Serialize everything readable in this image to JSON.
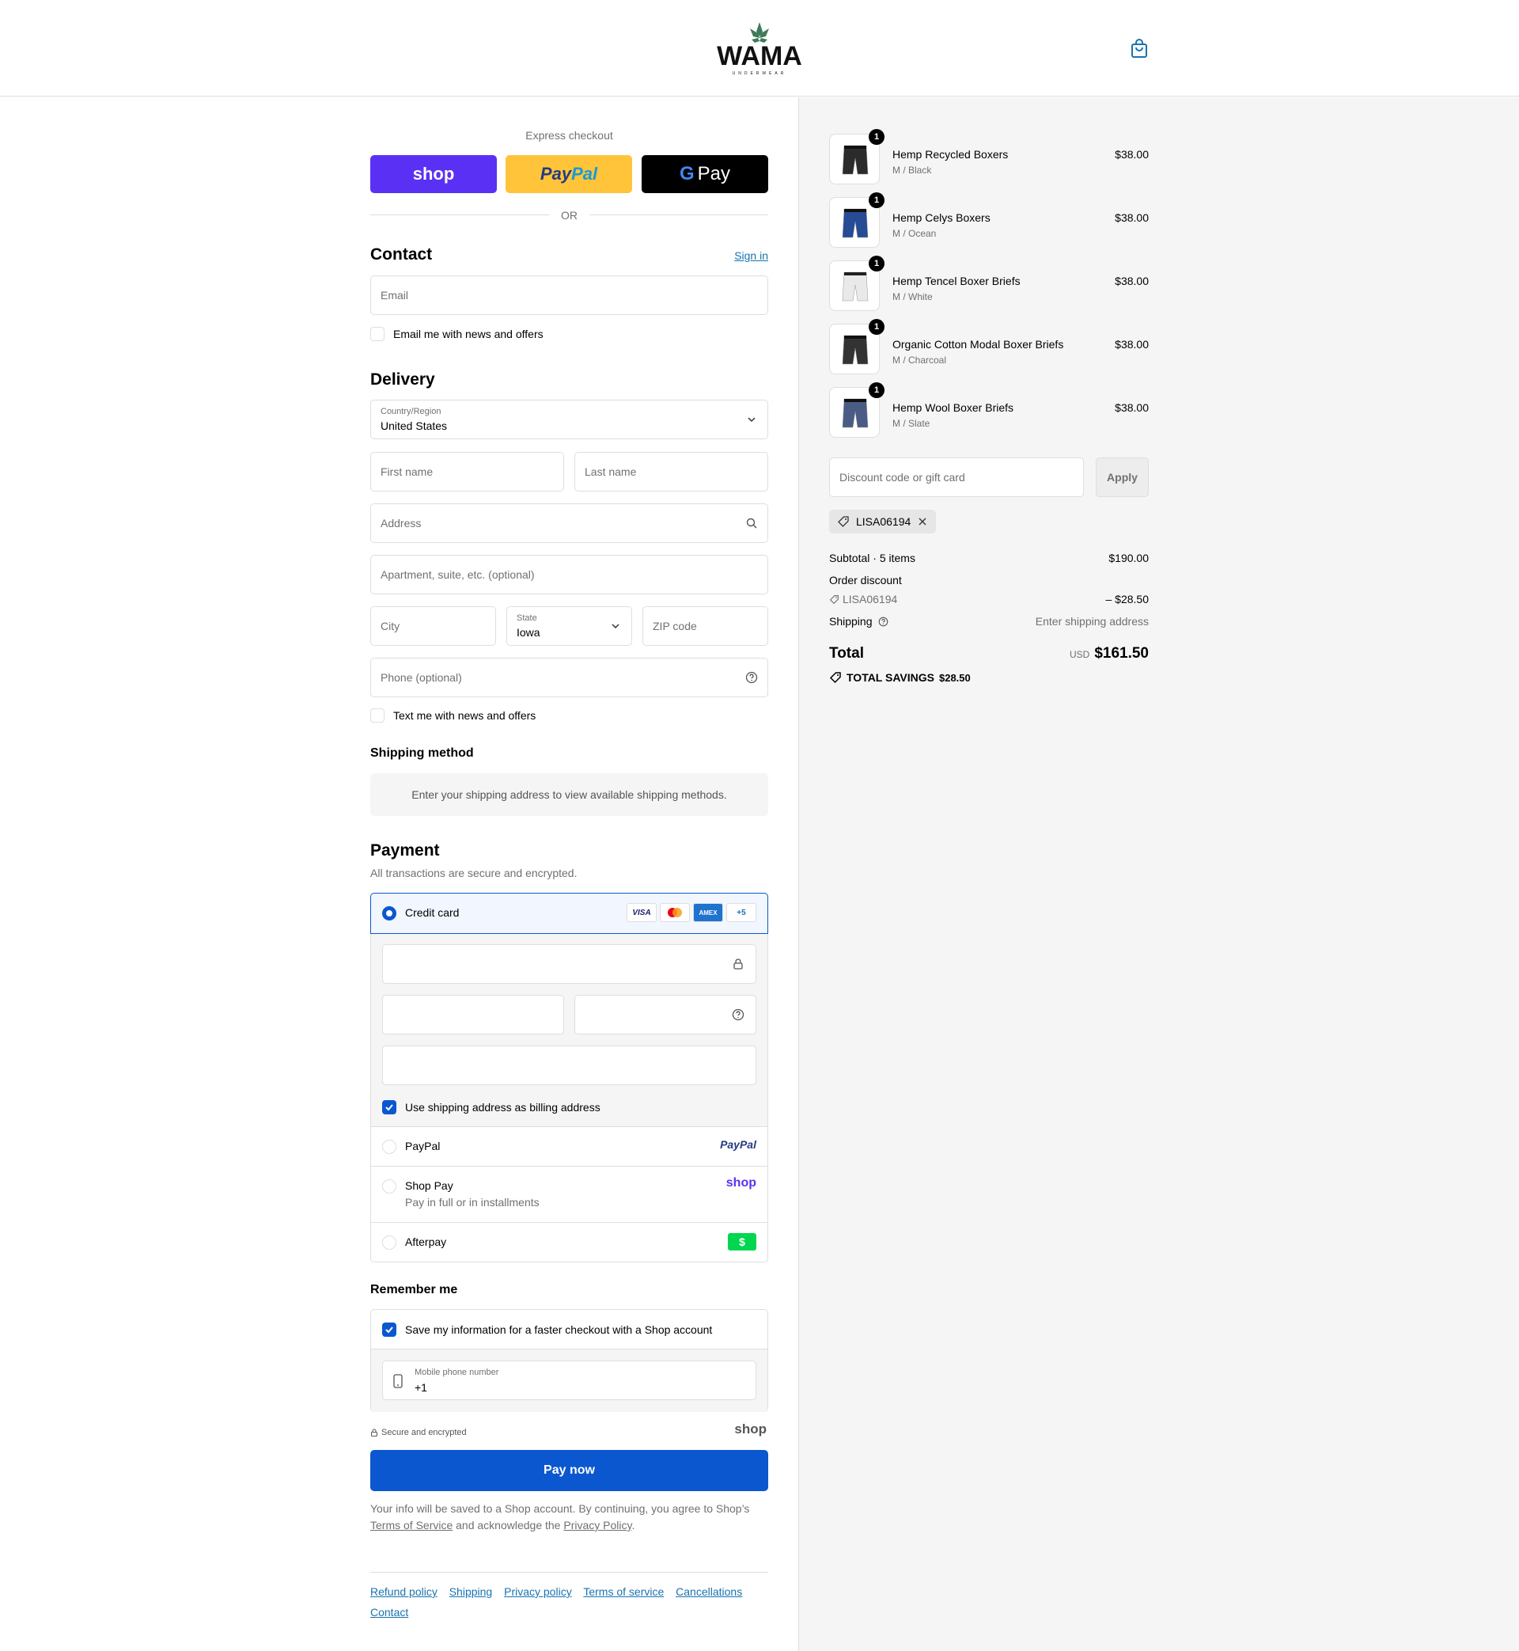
{
  "brand": {
    "logo_name": "WAMA",
    "logo_sub": "UNDERWEAR"
  },
  "express": {
    "label": "Express checkout",
    "shop_label": "shop",
    "paypal_label_1": "Pay",
    "paypal_label_2": "Pal",
    "gpay_label": "Pay",
    "or": "OR"
  },
  "contact": {
    "title": "Contact",
    "sign_in": "Sign in",
    "email_placeholder": "Email",
    "news_label": "Email me with news and offers"
  },
  "delivery": {
    "title": "Delivery",
    "country_label": "Country/Region",
    "country_value": "United States",
    "first_name": "First name",
    "last_name": "Last name",
    "address": "Address",
    "apartment": "Apartment, suite, etc. (optional)",
    "city": "City",
    "state_label": "State",
    "state_value": "Iowa",
    "zip": "ZIP code",
    "phone": "Phone (optional)",
    "text_label": "Text me with news and offers"
  },
  "shipping_method": {
    "title": "Shipping method",
    "message": "Enter your shipping address to view available shipping methods."
  },
  "payment": {
    "title": "Payment",
    "subtitle": "All transactions are secure and encrypted.",
    "credit_card": "Credit card",
    "cards": [
      "VISA",
      "MC",
      "AMEX",
      "+5"
    ],
    "billing_label": "Use shipping address as billing address",
    "paypal": "PayPal",
    "paypal_logo": "PayPal",
    "shop_pay": "Shop Pay",
    "shop_pay_sub": "Pay in full or in installments",
    "shop_logo": "shop",
    "afterpay": "Afterpay"
  },
  "remember": {
    "title": "Remember me",
    "save_label": "Save my information for a faster checkout with a Shop account",
    "phone_label": "Mobile phone number",
    "phone_value": "+1",
    "secure": "Secure and encrypted",
    "shop_logo": "shop"
  },
  "pay_now": "Pay now",
  "fine_print": {
    "text1": "Your info will be saved to a Shop account. By continuing, you agree to Shop’s",
    "tos": "Terms of Service",
    "text2": "and acknowledge the",
    "privacy": "Privacy Policy",
    "end": "."
  },
  "footer_links": [
    "Refund policy",
    "Shipping",
    "Privacy policy",
    "Terms of service",
    "Cancellations",
    "Contact"
  ],
  "items": [
    {
      "name": "Hemp Recycled Boxers",
      "variant": "M / Black",
      "price": "$38.00",
      "qty": "1",
      "color": "#2b2b2b"
    },
    {
      "name": "Hemp Celys Boxers",
      "variant": "M / Ocean",
      "price": "$38.00",
      "qty": "1",
      "color": "#274c96"
    },
    {
      "name": "Hemp Tencel Boxer Briefs",
      "variant": "M / White",
      "price": "$38.00",
      "qty": "1",
      "color": "#e9e9e9"
    },
    {
      "name": "Organic Cotton Modal Boxer Briefs",
      "variant": "M / Charcoal",
      "price": "$38.00",
      "qty": "1",
      "color": "#333333"
    },
    {
      "name": "Hemp Wool Boxer Briefs",
      "variant": "M / Slate",
      "price": "$38.00",
      "qty": "1",
      "color": "#4a5b85"
    }
  ],
  "discount": {
    "placeholder": "Discount code or gift card",
    "apply": "Apply",
    "code": "LISA06194"
  },
  "totals": {
    "subtotal_label": "Subtotal · 5 items",
    "subtotal": "$190.00",
    "order_discount": "Order discount",
    "code": "LISA06194",
    "discount_value": "– $28.50",
    "shipping_label": "Shipping",
    "shipping_value": "Enter shipping address",
    "total_label": "Total",
    "currency": "USD",
    "total": "$161.50",
    "savings_label": "TOTAL SAVINGS",
    "savings": "$28.50"
  }
}
